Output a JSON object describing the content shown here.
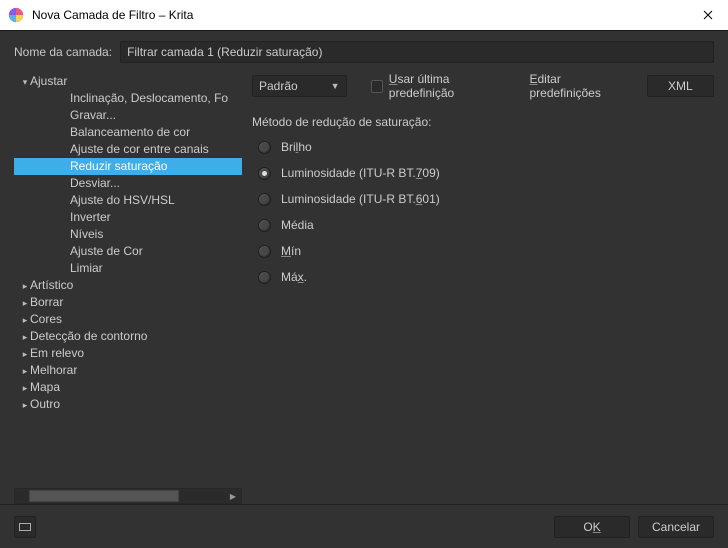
{
  "window": {
    "title": "Nova Camada de Filtro – Krita"
  },
  "layer": {
    "label": "Nome da camada:",
    "value": "Filtrar camada 1 (Reduzir saturação)"
  },
  "tree": {
    "parent": "Ajustar",
    "children": [
      "Inclinação, Deslocamento, Fo",
      "Gravar...",
      "Balanceamento de cor",
      "Ajuste de cor entre canais",
      "Reduzir saturação",
      "Desviar...",
      "Ajuste do HSV/HSL",
      "Inverter",
      "Níveis",
      "Ajuste de Cor",
      "Limiar"
    ],
    "selected_index": 4,
    "siblings": [
      "Artístico",
      "Borrar",
      "Cores",
      "Detecção de contorno",
      "Em relevo",
      "Melhorar",
      "Mapa",
      "Outro"
    ]
  },
  "preset": {
    "combo_value": "Padrão",
    "checkbox_pre": "U",
    "checkbox_label": "sar última predefinição",
    "edit_pre": "E",
    "edit_label": "ditar predefinições",
    "xml": "XML"
  },
  "method": {
    "heading": "Método de redução de saturação:",
    "options": [
      {
        "pre": "Bri",
        "u": "l",
        "post": "ho"
      },
      {
        "pre": "Luminosidade (ITU-R BT.",
        "u": "7",
        "post": "09)"
      },
      {
        "pre": "Luminosidade (ITU-R BT.",
        "u": "6",
        "post": "01)"
      },
      {
        "pre": "Média",
        "u": "",
        "post": ""
      },
      {
        "pre": "",
        "u": "M",
        "post": "ín"
      },
      {
        "pre": "Má",
        "u": "x",
        "post": "."
      }
    ],
    "selected_index": 1
  },
  "buttons": {
    "ok_pre": "O",
    "ok_u": "K",
    "cancel": "Cancelar"
  }
}
